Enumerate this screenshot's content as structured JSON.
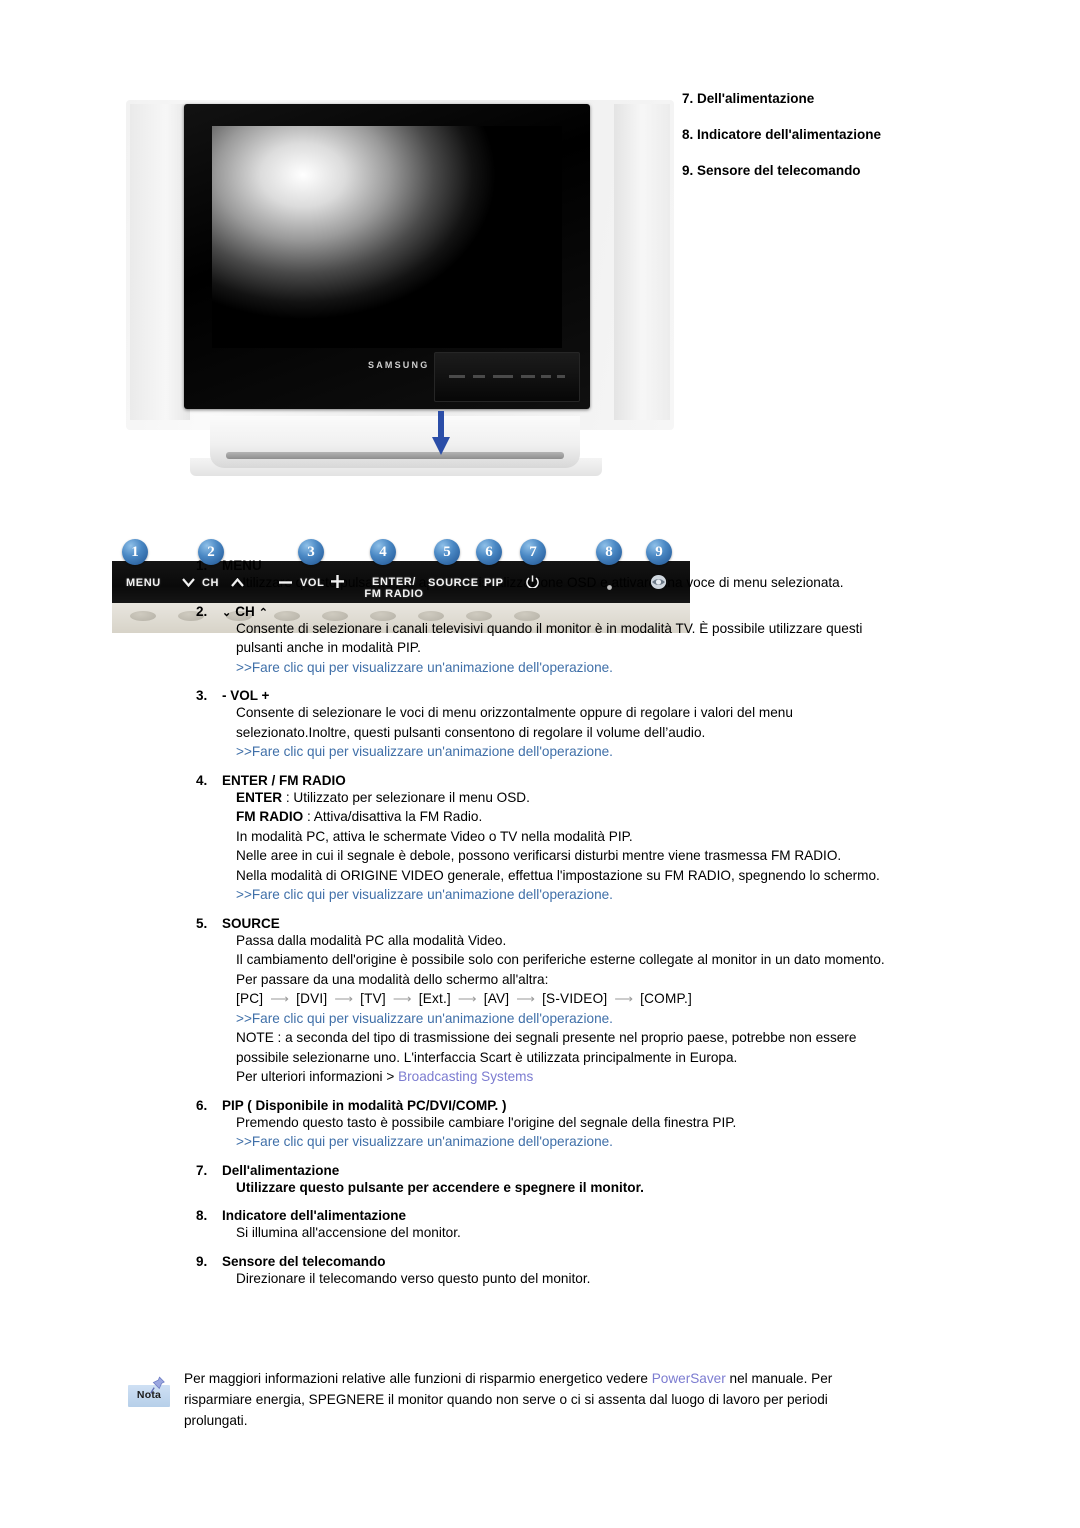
{
  "callouts": [
    "7. Dell'alimentazione",
    "8. Indicatore dell'alimentazione",
    "9. Sensore del telecomando"
  ],
  "device": {
    "brand": "SAMSUNG",
    "panel_buttons": [
      {
        "num": "1",
        "label": "MENU"
      },
      {
        "num": "2",
        "label": "CH"
      },
      {
        "num": "3",
        "label": "VOL"
      },
      {
        "num": "4",
        "label": "ENTER/\nFM RADIO"
      },
      {
        "num": "5",
        "label": "SOURCE"
      },
      {
        "num": "6",
        "label": "PIP"
      },
      {
        "num": "7",
        "label": "power"
      },
      {
        "num": "8",
        "label": "indicator"
      },
      {
        "num": "9",
        "label": "ir-sensor"
      }
    ],
    "badge_color": "#2a63a5"
  },
  "items": [
    {
      "num": "1.",
      "title": "MENU",
      "lines": [
        "Utilizzare questo pulsante per aprire la visualizzazione OSD e attivare una voce di menu selezionata."
      ],
      "link": null
    },
    {
      "num": "2.",
      "title_prefix": "⌄",
      "title": "CH",
      "title_suffix": "⌃",
      "lines": [
        "Consente di selezionare i canali televisivi quando il monitor è in modalità TV. È possibile utilizzare questi pulsanti anche in modalità PIP."
      ],
      "link": ">>Fare clic qui per visualizzare un'animazione dell'operazione."
    },
    {
      "num": "3.",
      "title": "- VOL +",
      "lines": [
        "Consente di selezionare le voci di menu orizzontalmente oppure di regolare i valori del menu selezionato.Inoltre, questi pulsanti consentono di regolare il volume dell’audio."
      ],
      "link": ">>Fare clic qui per visualizzare un'animazione dell'operazione."
    },
    {
      "num": "4.",
      "title": "ENTER / FM RADIO",
      "rich_lines": [
        {
          "bold": "ENTER",
          "rest": " : Utilizzato per selezionare il menu OSD."
        },
        {
          "bold": "FM RADIO",
          "rest": " : Attiva/disattiva la FM Radio."
        }
      ],
      "lines": [
        "In modalità PC, attiva le schermate Video o TV nella modalità PIP.",
        "Nelle aree in cui il segnale è debole, possono verificarsi disturbi mentre viene trasmessa FM RADIO.",
        "Nella modalità di ORIGINE VIDEO generale, effettua l'impostazione su FM RADIO, spegnendo lo schermo."
      ],
      "link": ">>Fare clic qui per visualizzare un'animazione dell'operazione."
    },
    {
      "num": "5.",
      "title": "SOURCE",
      "lines": [
        "Passa dalla modalità PC alla modalità Video.",
        "Il cambiamento dell'origine è possibile solo con periferiche esterne collegate al monitor in un dato momento.",
        "Per passare da una modalità dello schermo all'altra:"
      ],
      "source_flow": [
        "[PC]",
        "[DVI]",
        "[TV]",
        "[Ext.]",
        "[AV]",
        "[S-VIDEO]",
        "[COMP.]"
      ],
      "link": ">>Fare clic qui per visualizzare un'animazione dell'operazione.",
      "after_lines": [
        "NOTE : a seconda del tipo di trasmissione dei segnali presente nel proprio paese, potrebbe non essere possibile selezionarne uno. L'interfaccia Scart è utilizzata principalmente in Europa."
      ],
      "more_info_prefix": "Per ulteriori informazioni > ",
      "more_info_link": "Broadcasting Systems"
    },
    {
      "num": "6.",
      "title": "PIP ( Disponibile in modalità PC/DVI/COMP. )",
      "lines": [
        "Premendo questo tasto è possibile cambiare l'origine del segnale della finestra PIP."
      ],
      "link": ">>Fare clic qui per visualizzare un'animazione dell'operazione."
    },
    {
      "num": "7.",
      "title": "Dell'alimentazione",
      "bold_body": true,
      "lines": [
        "Utilizzare questo pulsante per accendere e spegnere il monitor."
      ],
      "link": null
    },
    {
      "num": "8.",
      "title": "Indicatore dell'alimentazione",
      "lines": [
        "Si illumina all'accensione del monitor."
      ],
      "link": null
    },
    {
      "num": "9.",
      "title": "Sensore del telecomando",
      "lines": [
        "Direzionare il telecomando verso questo punto del monitor."
      ],
      "link": null
    }
  ],
  "nota": {
    "icon_label": "Nota",
    "text_before": "Per maggiori informazioni relative alle funzioni di risparmio energetico vedere ",
    "link": "PowerSaver",
    "text_after": " nel manuale. Per risparmiare energia, SPEGNERE il monitor quando non serve o ci si assenta dal luogo di lavoro per periodi prolungati."
  },
  "colors": {
    "link_blue": "#3f6fa8",
    "link_violet": "#7b7bd0",
    "badge_blue": "#2a63a5"
  }
}
